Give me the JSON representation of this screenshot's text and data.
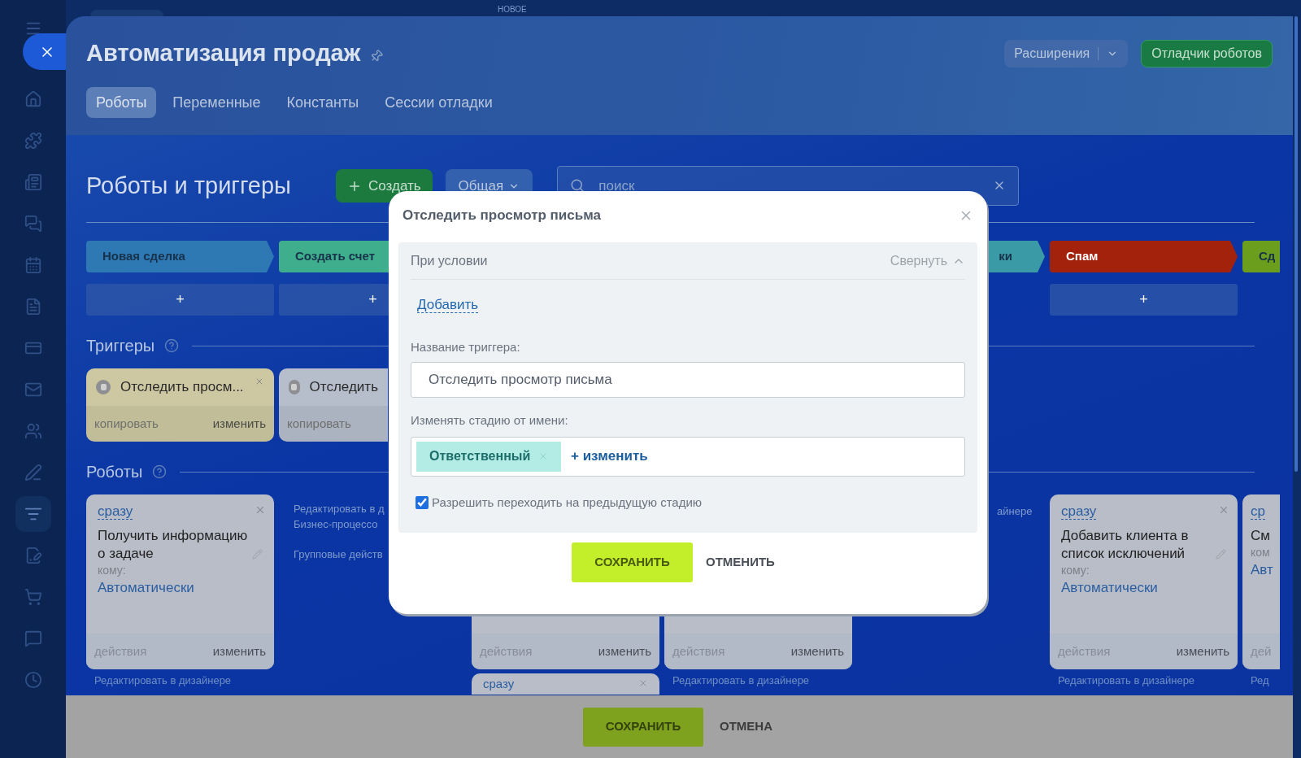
{
  "top_strip": {
    "label": "НОВОЕ"
  },
  "sidebar": {
    "items": [
      {
        "selected": false
      },
      {
        "selected": false
      },
      {
        "selected": false
      },
      {
        "selected": false
      },
      {
        "selected": false
      },
      {
        "selected": false
      },
      {
        "selected": false
      },
      {
        "selected": false
      },
      {
        "selected": false
      },
      {
        "selected": false
      },
      {
        "selected": true
      },
      {
        "selected": false
      },
      {
        "selected": false
      },
      {
        "selected": false
      },
      {
        "selected": false
      }
    ]
  },
  "header": {
    "title": "Автоматизация продаж",
    "tabs": [
      {
        "label": "Роботы",
        "selected": true
      },
      {
        "label": "Переменные",
        "selected": false
      },
      {
        "label": "Константы",
        "selected": false
      },
      {
        "label": "Сессии отладки",
        "selected": false
      }
    ],
    "extensions_button": "Расширения",
    "debugger_button": "Отладчик роботов"
  },
  "toolbar": {
    "title": "Роботы и триггеры",
    "create_button": "Создать",
    "filter": "Общая",
    "search": {
      "placeholder": "поиск"
    }
  },
  "stages_left": [
    {
      "label": "Новая сделка",
      "color": "#2e79b4",
      "add": "+"
    },
    {
      "label": "Создать счет",
      "color": "#3fae8c",
      "add": "+"
    }
  ],
  "stages_right": [
    {
      "label": "ки",
      "color": "#3a9aa6"
    },
    {
      "label": "Спам",
      "color": "#a3220b",
      "add": "+"
    },
    {
      "label": "Сд",
      "color": "#6a9e1c"
    }
  ],
  "triggers": {
    "title": "Триггеры",
    "cards": [
      {
        "name": "Отследить просм...",
        "copy": "копировать",
        "edit": "изменить",
        "color": "#cdc8a2"
      },
      {
        "name": "Отследить",
        "copy": "копировать",
        "color": "#b6bdcb"
      }
    ]
  },
  "robots": {
    "title": "Роботы",
    "card_first": {
      "delay": "сразу",
      "name": "Получить информацию о задаче",
      "to_label": "кому:",
      "to": "Автоматически",
      "actions": "действия",
      "edit": "изменить",
      "designer_link": "Редактировать в дизайнере"
    },
    "side_links": [
      "Редактировать в д",
      "Бизнес-процессо",
      "Групповые действ"
    ],
    "hidden_cards": [
      {
        "actions": "действия",
        "edit": "изменить",
        "next_delay": "сразу"
      },
      {
        "actions": "действия",
        "edit": "изменить",
        "designer_link": "Редактировать в дизайнере"
      }
    ],
    "side_link_right": "айнере",
    "card_right": {
      "delay": "сразу",
      "name": "Добавить клиента в список исключений",
      "to_label": "кому:",
      "to": "Автоматически",
      "actions": "действия",
      "edit": "изменить",
      "designer_link": "Редактировать в дизайнере"
    },
    "card_cut": {
      "delay": "ср",
      "name": "См",
      "to_label": "ком",
      "to": "Авт",
      "actions": "дей",
      "designer_link": "Ред"
    }
  },
  "modal": {
    "title": "Отследить просмотр письма",
    "condition": {
      "label": "При условии",
      "collapse": "Свернуть",
      "add_link": "Добавить"
    },
    "name_field": {
      "label": "Название триггера:",
      "value": "Отследить просмотр письма"
    },
    "user_field": {
      "label": "Изменять стадию от имени:",
      "chip": "Ответственный",
      "change_link": "+ изменить"
    },
    "allow_back": {
      "label": "Разрешить переходить на предыдущую стадию",
      "checked": true
    },
    "save": "СОХРАНИТЬ",
    "cancel": "ОТМЕНИТЬ"
  },
  "bottom_bar": {
    "save": "СОХРАНИТЬ",
    "cancel": "ОТМЕНА"
  }
}
